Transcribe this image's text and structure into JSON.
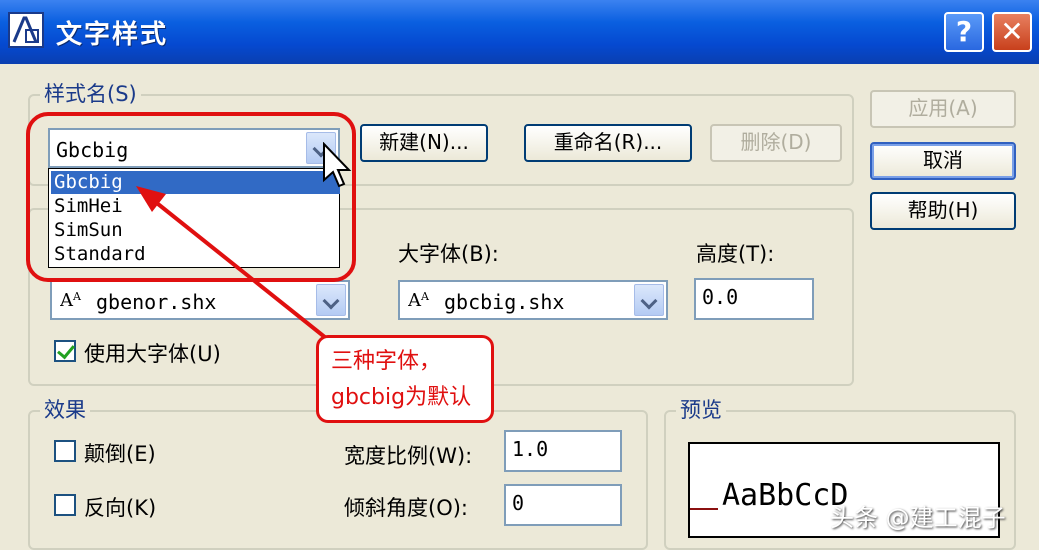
{
  "window": {
    "title": "文字样式"
  },
  "titlebar": {
    "help_label": "?",
    "close_label": "✕"
  },
  "style_name_group": {
    "title": "样式名(S)",
    "selected_style": "Gbcbig",
    "dropdown_items": [
      "Gbcbig",
      "SimHei",
      "SimSun",
      "Standard"
    ],
    "new_button": "新建(N)...",
    "rename_button": "重命名(R)...",
    "delete_button": "删除(D)"
  },
  "font_group": {
    "bigfont_label": "大字体(B):",
    "height_label": "高度(T):",
    "font_value": "gbenor.shx",
    "bigfont_value": "gbcbig.shx",
    "height_value": "0.0",
    "use_bigfont_label": "使用大字体(U)",
    "use_bigfont_checked": true
  },
  "effects_group": {
    "title": "效果",
    "upside_down_label": "颠倒(E)",
    "backwards_label": "反向(K)",
    "width_factor_label": "宽度比例(W):",
    "width_factor_value": "1.0",
    "oblique_angle_label": "倾斜角度(O):",
    "oblique_angle_value": "0"
  },
  "preview_group": {
    "title": "预览",
    "sample_text": "AaBbCcD"
  },
  "right_buttons": {
    "apply": "应用(A)",
    "cancel": "取消",
    "help": "帮助(H)"
  },
  "annotation": {
    "line1": "三种字体，",
    "line2": "gbcbig为默认"
  },
  "watermark": "头条 @建工混子",
  "colors": {
    "titlebar": "#0a5fe0",
    "annotation_red": "#e01010",
    "selection": "#316ac5",
    "dialog_bg": "#ece9d8"
  }
}
